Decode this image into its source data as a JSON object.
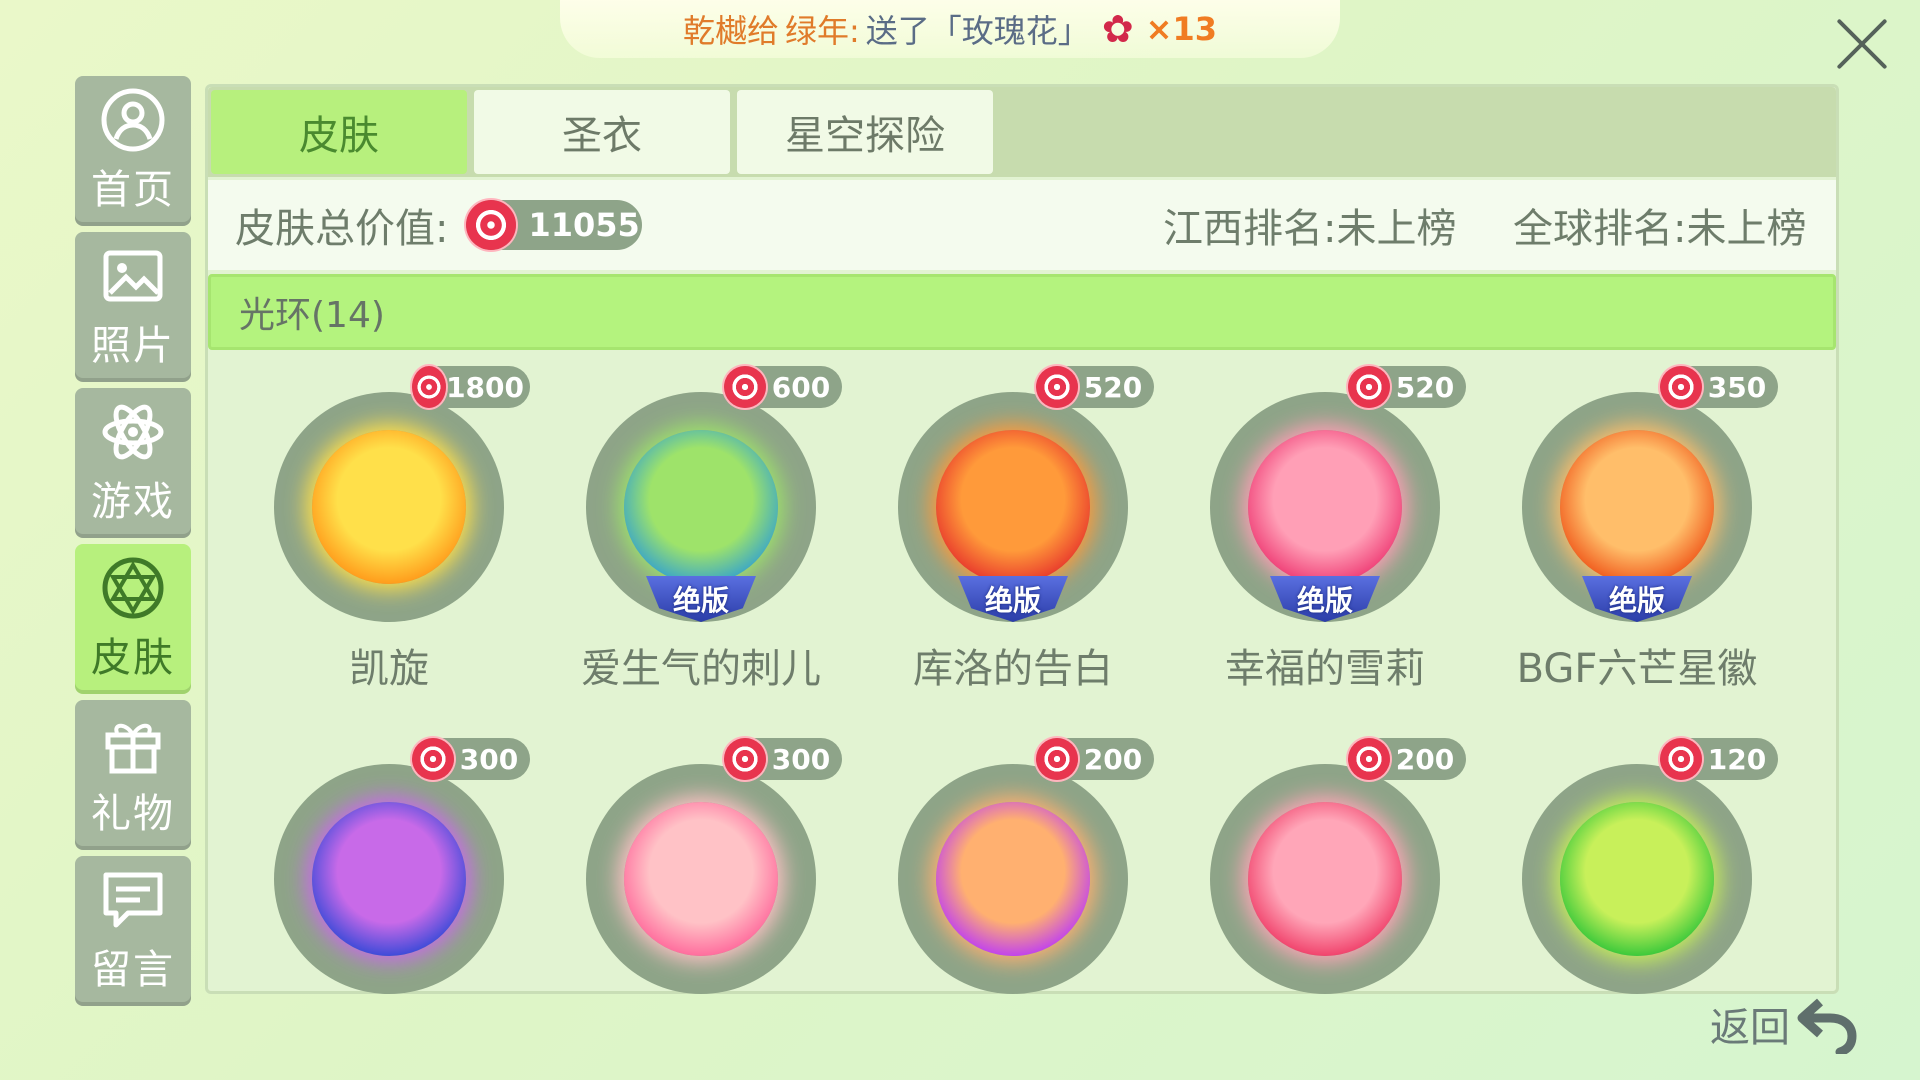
{
  "banner": {
    "sender": "乾樾给",
    "receiver": "绿年:",
    "action": "送了「玫瑰花」",
    "count": "×13",
    "gift_icon": "rose-icon"
  },
  "sidebar": {
    "items": [
      {
        "label": "首页",
        "icon": "profile-icon"
      },
      {
        "label": "照片",
        "icon": "photo-icon"
      },
      {
        "label": "游戏",
        "icon": "atom-icon"
      },
      {
        "label": "皮肤",
        "icon": "skin-icon",
        "active": true
      },
      {
        "label": "礼物",
        "icon": "gift-icon"
      },
      {
        "label": "留言",
        "icon": "message-icon"
      }
    ]
  },
  "tabs": [
    {
      "label": "皮肤",
      "active": true
    },
    {
      "label": "圣衣"
    },
    {
      "label": "星空探险"
    }
  ],
  "stats": {
    "total_label": "皮肤总价值:",
    "total_value": "11055",
    "rank_region": "江西排名:未上榜",
    "rank_global": "全球排名:未上榜"
  },
  "section": {
    "title": "光环(14)"
  },
  "items": [
    {
      "name": "凯旋",
      "price": "1800",
      "limited": false,
      "colors": [
        "#ffe04a",
        "#ff9a1a"
      ]
    },
    {
      "name": "爱生气的刺儿",
      "price": "600",
      "limited": true,
      "colors": [
        "#9ee36a",
        "#3aa6c8"
      ]
    },
    {
      "name": "库洛的告白",
      "price": "520",
      "limited": true,
      "colors": [
        "#ff9a3a",
        "#e8392c"
      ]
    },
    {
      "name": "幸福的雪莉",
      "price": "520",
      "limited": true,
      "colors": [
        "#ff9fb6",
        "#ef3e76"
      ]
    },
    {
      "name": "BGF六芒星徽",
      "price": "350",
      "limited": true,
      "colors": [
        "#ffbe6a",
        "#f05a1c"
      ]
    },
    {
      "name": "",
      "price": "300",
      "limited": false,
      "colors": [
        "#c86ae8",
        "#3a4ad8"
      ]
    },
    {
      "name": "",
      "price": "300",
      "limited": false,
      "colors": [
        "#ffc2c6",
        "#ff6a9c"
      ]
    },
    {
      "name": "",
      "price": "200",
      "limited": false,
      "colors": [
        "#ffb070",
        "#c040f0"
      ]
    },
    {
      "name": "",
      "price": "200",
      "limited": false,
      "colors": [
        "#ffa6b8",
        "#f0406a"
      ]
    },
    {
      "name": "",
      "price": "120",
      "limited": false,
      "colors": [
        "#c8f05a",
        "#38c83a"
      ]
    }
  ],
  "limited_badge": "绝版",
  "back_label": "返回"
}
